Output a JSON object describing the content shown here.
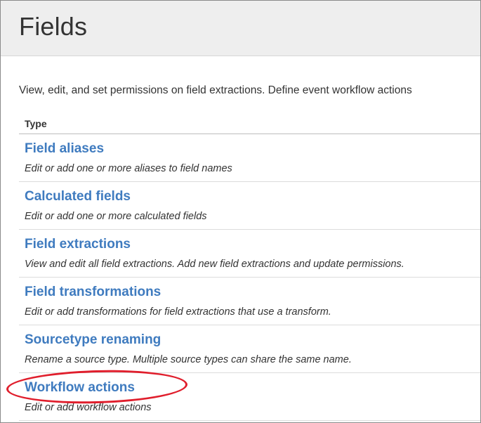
{
  "page": {
    "title": "Fields",
    "description": "View, edit, and set permissions on field extractions. Define event workflow actions"
  },
  "table": {
    "column_header": "Type",
    "rows": [
      {
        "label": "Field aliases",
        "description": "Edit or add one or more aliases to field names"
      },
      {
        "label": "Calculated fields",
        "description": "Edit or add one or more calculated fields"
      },
      {
        "label": "Field extractions",
        "description": "View and edit all field extractions. Add new field extractions and update permissions."
      },
      {
        "label": "Field transformations",
        "description": "Edit or add transformations for field extractions that use a transform."
      },
      {
        "label": "Sourcetype renaming",
        "description": "Rename a source type. Multiple source types can share the same name."
      },
      {
        "label": "Workflow actions",
        "description": "Edit or add workflow actions"
      }
    ]
  },
  "annotation": {
    "highlight_color": "#e01e2c",
    "highlighted_item": "Workflow actions"
  },
  "colors": {
    "link": "#3f7bbf",
    "header_bg": "#eeeeee",
    "text": "#333333"
  }
}
